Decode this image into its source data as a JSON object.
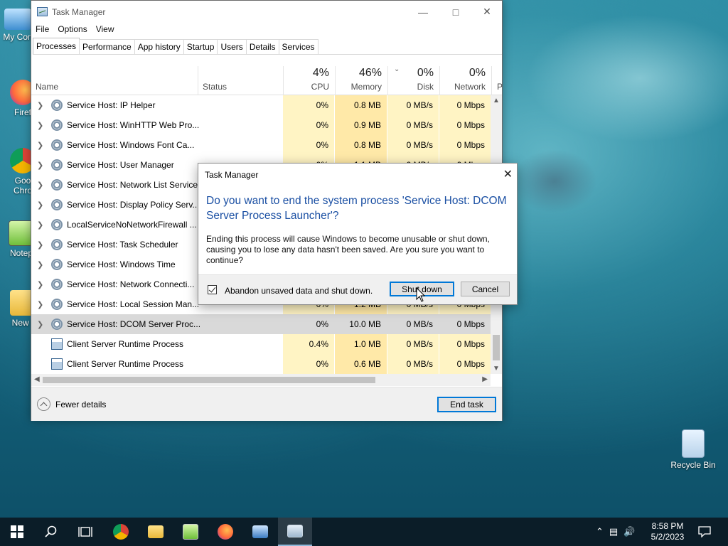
{
  "desktop": {
    "icons": [
      {
        "label": "My Con"
      },
      {
        "label": "Firef"
      },
      {
        "label": "Goo"
      },
      {
        "label": "Chro"
      },
      {
        "label": "Notep"
      },
      {
        "label": "New f"
      },
      {
        "label": "Recycle Bin"
      }
    ]
  },
  "task_manager": {
    "title": "Task Manager",
    "menu": [
      "File",
      "Options",
      "View"
    ],
    "tabs": [
      "Processes",
      "Performance",
      "App history",
      "Startup",
      "Users",
      "Details",
      "Services"
    ],
    "active_tab": "Processes",
    "columns": {
      "name": "Name",
      "status": "Status",
      "cpu_pct": "4%",
      "cpu_label": "CPU",
      "mem_pct": "46%",
      "mem_label": "Memory",
      "disk_pct": "0%",
      "disk_label": "Disk",
      "net_pct": "0%",
      "net_label": "Network",
      "cut_label": "P"
    },
    "processes": [
      {
        "name": "Service Host: IP Helper",
        "cpu": "0%",
        "memory": "0.8 MB",
        "disk": "0 MB/s",
        "network": "0 Mbps",
        "icon": "gear-icon",
        "expandable": true
      },
      {
        "name": "Service Host: WinHTTP Web Pro...",
        "cpu": "0%",
        "memory": "0.9 MB",
        "disk": "0 MB/s",
        "network": "0 Mbps",
        "icon": "gear-icon",
        "expandable": true
      },
      {
        "name": "Service Host: Windows Font Ca...",
        "cpu": "0%",
        "memory": "0.8 MB",
        "disk": "0 MB/s",
        "network": "0 Mbps",
        "icon": "gear-icon",
        "expandable": true
      },
      {
        "name": "Service Host: User Manager",
        "cpu": "0%",
        "memory": "1.1 MB",
        "disk": "0 MB/s",
        "network": "0 Mbps",
        "icon": "gear-icon",
        "expandable": true
      },
      {
        "name": "Service Host: Network List Service",
        "cpu": "",
        "memory": "",
        "disk": "",
        "network": "",
        "icon": "gear-icon",
        "expandable": true
      },
      {
        "name": "Service Host: Display Policy Serv...",
        "cpu": "",
        "memory": "",
        "disk": "",
        "network": "",
        "icon": "gear-icon",
        "expandable": true
      },
      {
        "name": "LocalServiceNoNetworkFirewall ...",
        "cpu": "",
        "memory": "",
        "disk": "",
        "network": "",
        "icon": "gear-icon",
        "expandable": true
      },
      {
        "name": "Service Host: Task Scheduler",
        "cpu": "",
        "memory": "",
        "disk": "",
        "network": "",
        "icon": "gear-icon",
        "expandable": true
      },
      {
        "name": "Service Host: Windows Time",
        "cpu": "",
        "memory": "",
        "disk": "",
        "network": "",
        "icon": "gear-icon",
        "expandable": true
      },
      {
        "name": "Service Host: Network Connecti...",
        "cpu": "",
        "memory": "",
        "disk": "",
        "network": "",
        "icon": "gear-icon",
        "expandable": true
      },
      {
        "name": "Service Host: Local Session Man...",
        "cpu": "0%",
        "memory": "1.2 MB",
        "disk": "0 MB/s",
        "network": "0 Mbps",
        "icon": "gear-icon",
        "expandable": true
      },
      {
        "name": "Service Host: DCOM Server Proc...",
        "cpu": "0%",
        "memory": "10.0 MB",
        "disk": "0 MB/s",
        "network": "0 Mbps",
        "icon": "gear-icon",
        "expandable": true,
        "selected": true
      },
      {
        "name": "Client Server Runtime Process",
        "cpu": "0.4%",
        "memory": "1.0 MB",
        "disk": "0 MB/s",
        "network": "0 Mbps",
        "icon": "window-icon",
        "expandable": false
      },
      {
        "name": "Client Server Runtime Process",
        "cpu": "0%",
        "memory": "0.6 MB",
        "disk": "0 MB/s",
        "network": "0 Mbps",
        "icon": "window-icon",
        "expandable": false
      }
    ],
    "fewer_details": "Fewer details",
    "end_task": "End task"
  },
  "dialog": {
    "title": "Task Manager",
    "question": "Do you want to end the system process 'Service Host: DCOM Server Process Launcher'?",
    "body": "Ending this process will cause Windows to become unusable or shut down, causing you to lose any data hasn't been saved. Are you sure you want to continue?",
    "checkbox_label": "Abandon unsaved data and shut down.",
    "checkbox_checked": true,
    "shutdown": "Shut down",
    "cancel": "Cancel"
  },
  "taskbar": {
    "time": "8:58 PM",
    "date": "5/2/2023"
  },
  "colors": {
    "question_blue": "#1a4fa3",
    "accent": "#0078d7",
    "cpu_bg": "#fff4c4",
    "memory_bg": "#ffe9a8"
  }
}
